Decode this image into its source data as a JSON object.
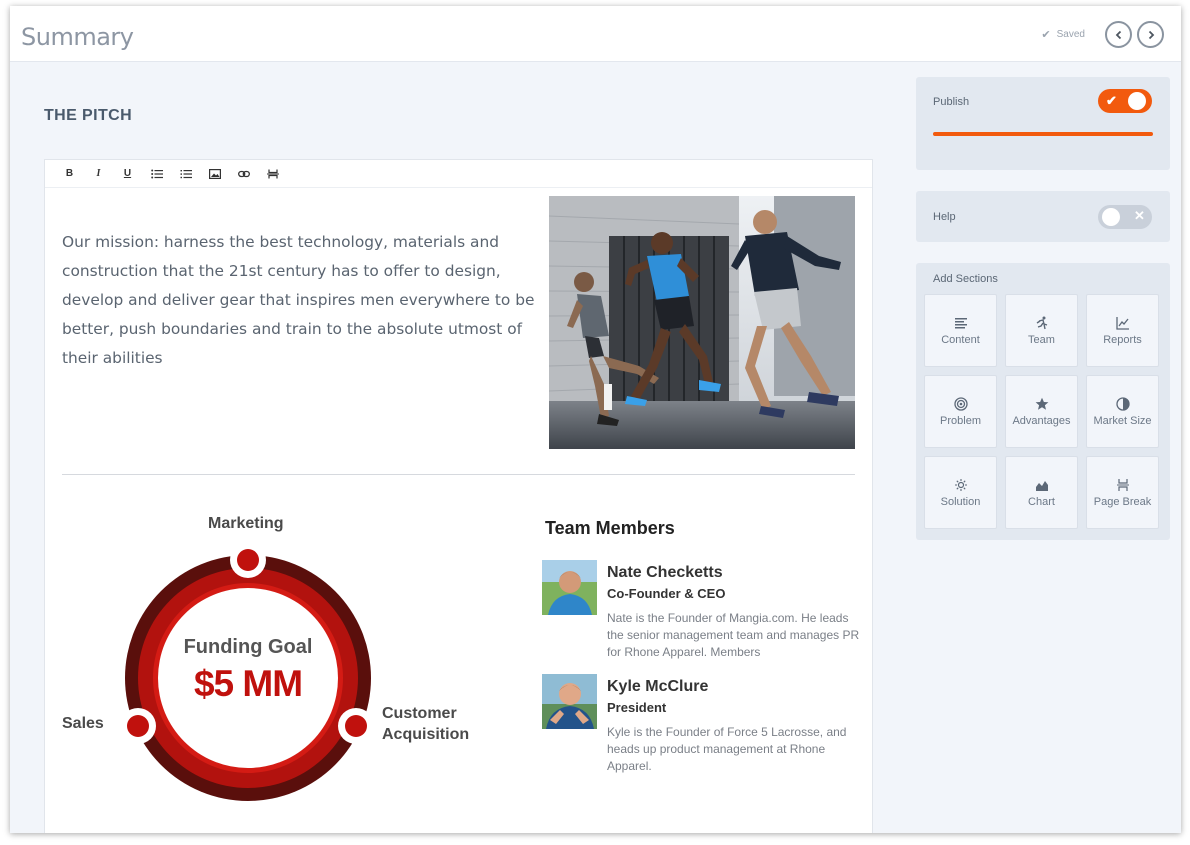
{
  "header": {
    "title": "Summary",
    "saved_label": "Saved"
  },
  "section": {
    "title": "THE PITCH"
  },
  "mission": {
    "text": "Our mission: harness the best technology, materials and construction that the 21st century has to offer to design, develop and deliver gear that inspires men everywhere to be better, push boundaries and train to the absolute utmost of their abilities"
  },
  "funding": {
    "heading": "Funding Goal",
    "amount": "$5 MM",
    "labels": {
      "marketing": "Marketing",
      "sales": "Sales",
      "customer_1": "Customer",
      "customer_2": "Acquisition"
    },
    "colors": {
      "primary": "#c0110d",
      "dark": "#5a0f0c"
    }
  },
  "team": {
    "title": "Team Members",
    "members": [
      {
        "name": "Nate Checketts",
        "role": "Co-Founder & CEO",
        "bio": "Nate is the Founder of Mangia.com. He leads the senior management team and manages PR for Rhone Apparel. Members"
      },
      {
        "name": "Kyle McClure",
        "role": "President",
        "bio": "Kyle is the Founder of Force 5 Lacrosse, and heads up product management at Rhone Apparel."
      }
    ]
  },
  "sidebar": {
    "publish": {
      "label": "Publish",
      "on": true,
      "color": "#f25a0e"
    },
    "help": {
      "label": "Help",
      "on": false
    },
    "add_sections": {
      "label": "Add Sections",
      "items": [
        {
          "label": "Content",
          "icon": "content-icon"
        },
        {
          "label": "Team",
          "icon": "runner-icon"
        },
        {
          "label": "Reports",
          "icon": "line-chart-icon"
        },
        {
          "label": "Problem",
          "icon": "target-icon"
        },
        {
          "label": "Advantages",
          "icon": "star-icon"
        },
        {
          "label": "Market Size",
          "icon": "pie-icon"
        },
        {
          "label": "Solution",
          "icon": "lightbulb-icon"
        },
        {
          "label": "Chart",
          "icon": "area-chart-icon"
        },
        {
          "label": "Page Break",
          "icon": "page-break-icon"
        }
      ]
    }
  }
}
